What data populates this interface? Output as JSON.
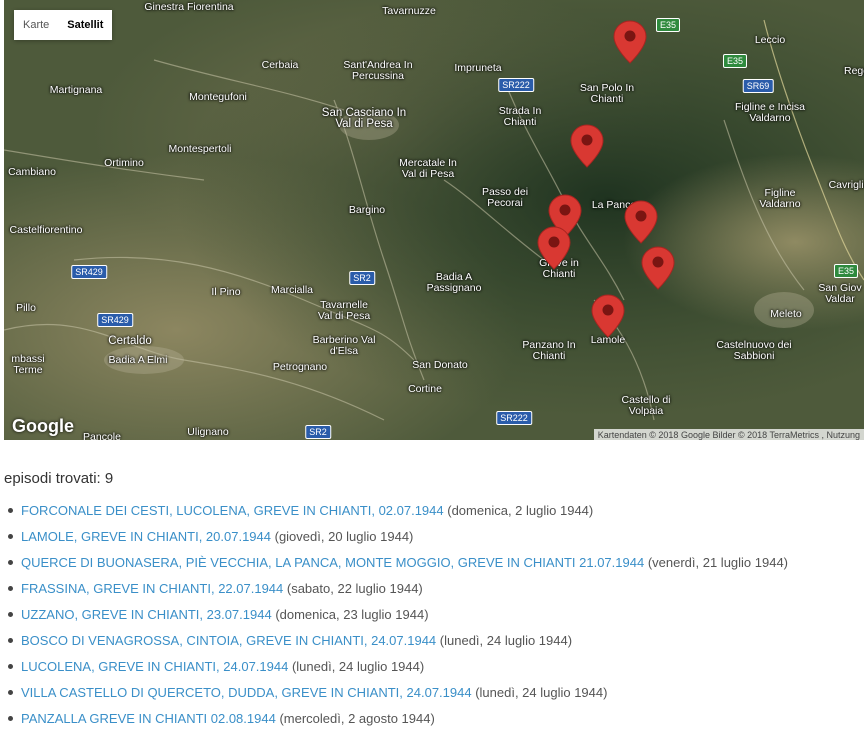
{
  "map": {
    "controls": {
      "map_label": "Karte",
      "satellite_label": "Satellit",
      "active": "satellite"
    },
    "logo": "Google",
    "attribution": "Kartendaten © 2018 Google Bilder © 2018 TerraMetrics , Nutzung",
    "place_labels": [
      "Ginestra Fiorentina",
      "Tavarnuzze",
      "Cerbaia",
      "Sant'Andrea In Percussina",
      "Impruneta",
      "San Polo In Chianti",
      "Leccio",
      "Regg",
      "Martignana",
      "Montegufoni",
      "San Casciano In Val di Pesa",
      "Strada In Chianti",
      "Figline e Incisa Valdarno",
      "Ortimino",
      "Montespertoli",
      "Mercatale In Val di Pesa",
      "Cambiano",
      "Passo dei Pecorai",
      "La Panca",
      "Figline Valdarno",
      "Cavriglia",
      "Castelfiorentino",
      "Bargino",
      "Greve in Chianti",
      "Il Pino",
      "Marcialla",
      "Badia A Passignano",
      "Tavarnelle Val di Pesa",
      "San Giov Valdar",
      "Pillo",
      "Certaldo",
      "Barberino Val d'Elsa",
      "Panzano In Chianti",
      "Lamole",
      "Meleto",
      "Castelnuovo dei Sabbioni",
      "Badia A Elmi",
      "mbassi Terme",
      "Petrognano",
      "San Donato",
      "Cortine",
      "Castello di Volpaia",
      "Pancole",
      "Ulignano"
    ],
    "road_labels": [
      "SR222",
      "SR222",
      "E35",
      "E35",
      "SR69",
      "E35",
      "SR429",
      "SR429",
      "SR2",
      "SR2"
    ],
    "marker_icon": "map-pin-icon",
    "marker_color": "#d93832",
    "markers": [
      {
        "name": "marker-forconale-lucolena"
      },
      {
        "name": "marker-lamole"
      },
      {
        "name": "marker-querce-di-buonasera"
      },
      {
        "name": "marker-frassina"
      },
      {
        "name": "marker-uzzano"
      },
      {
        "name": "marker-bosco-di-venagrossa"
      },
      {
        "name": "marker-lucolena"
      },
      {
        "name": "marker-villa-castello-di-querceto"
      }
    ]
  },
  "results": {
    "heading": "episodi trovati: 9",
    "items": [
      {
        "link": "FORCONALE DEI CESTI, LUCOLENA, GREVE IN CHIANTI, 02.07.1944",
        "date": " (domenica, 2 luglio 1944)"
      },
      {
        "link": "LAMOLE, GREVE IN CHIANTI, 20.07.1944",
        "date": " (giovedì, 20 luglio 1944)"
      },
      {
        "link": "QUERCE DI BUONASERA, PIÈ VECCHIA, LA PANCA, MONTE MOGGIO, GREVE IN CHIANTI 21.07.1944",
        "date": " (venerdì, 21 luglio 1944)"
      },
      {
        "link": "FRASSINA, GREVE IN CHIANTI, 22.07.1944",
        "date": " (sabato, 22 luglio 1944)"
      },
      {
        "link": "UZZANO, GREVE IN CHIANTI, 23.07.1944",
        "date": " (domenica, 23 luglio 1944)"
      },
      {
        "link": "BOSCO DI VENAGROSSA, CINTOIA, GREVE IN CHIANTI, 24.07.1944",
        "date": " (lunedì, 24 luglio 1944)"
      },
      {
        "link": "LUCOLENA, GREVE IN CHIANTI, 24.07.1944",
        "date": " (lunedì, 24 luglio 1944)"
      },
      {
        "link": "VILLA CASTELLO DI QUERCETO, DUDDA, GREVE IN CHIANTI, 24.07.1944",
        "date": " (lunedì, 24 luglio 1944)"
      },
      {
        "link": "PANZALLA GREVE IN CHIANTI 02.08.1944",
        "date": " (mercoledì, 2 agosto 1944)"
      }
    ]
  }
}
